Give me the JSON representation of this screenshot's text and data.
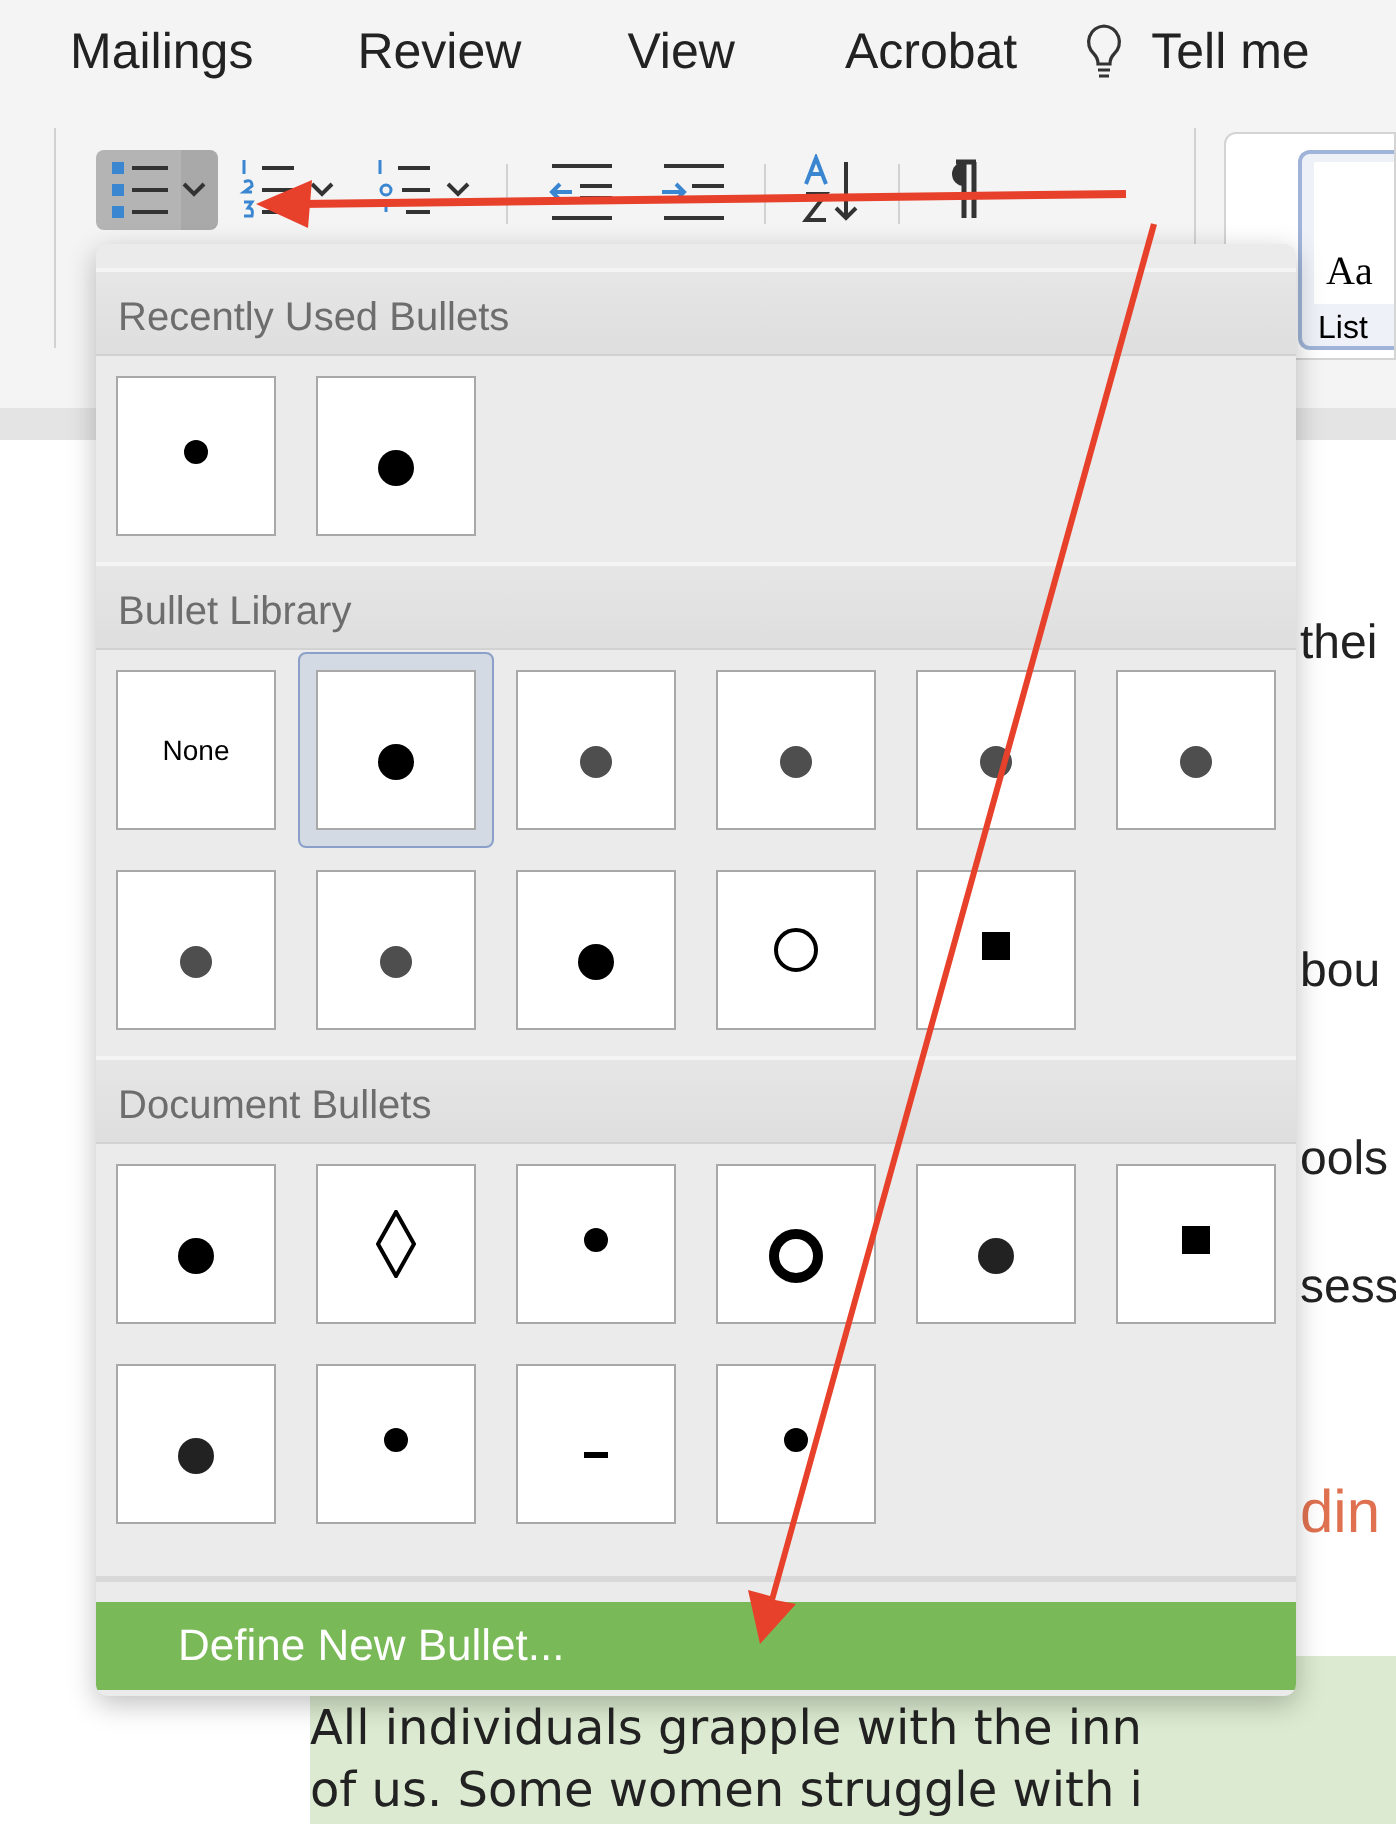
{
  "ribbon_tabs": [
    {
      "label": "Mailings"
    },
    {
      "label": "Review"
    },
    {
      "label": "View"
    },
    {
      "label": "Acrobat"
    }
  ],
  "tell_me": {
    "label": "Tell me"
  },
  "toolbar": {
    "bullets_pressed": true
  },
  "style_gallery": {
    "preview": "Aa",
    "name": "List"
  },
  "document": {
    "fragments": [
      {
        "text": "thei",
        "kind": "body"
      },
      {
        "text": "bou",
        "kind": "body"
      },
      {
        "text": "ools",
        "kind": "body"
      },
      {
        "text": "sess",
        "kind": "body"
      },
      {
        "text": "din",
        "kind": "heading"
      }
    ],
    "highlighted_lines": [
      "All individuals grapple with the inn",
      "of us. Some women struggle with i"
    ]
  },
  "bullet_menu": {
    "sections": [
      {
        "title": "Recently Used Bullets",
        "items": [
          {
            "kind": "dot-small",
            "selected": false
          },
          {
            "kind": "dot",
            "selected": false
          }
        ]
      },
      {
        "title": "Bullet Library",
        "items": [
          {
            "kind": "none",
            "label": "None",
            "selected": false
          },
          {
            "kind": "dot",
            "selected": true
          },
          {
            "kind": "dot-grey",
            "selected": false
          },
          {
            "kind": "dot-grey",
            "selected": false
          },
          {
            "kind": "dot-grey",
            "selected": false
          },
          {
            "kind": "dot-grey",
            "selected": false
          },
          {
            "kind": "dot-grey",
            "selected": false
          },
          {
            "kind": "dot-grey",
            "selected": false
          },
          {
            "kind": "dot",
            "selected": false
          },
          {
            "kind": "ring",
            "selected": false
          },
          {
            "kind": "square",
            "selected": false
          }
        ]
      },
      {
        "title": "Document Bullets",
        "items": [
          {
            "kind": "dot",
            "selected": false
          },
          {
            "kind": "diamond",
            "selected": false
          },
          {
            "kind": "dot-small",
            "selected": false
          },
          {
            "kind": "letter-o",
            "selected": false
          },
          {
            "kind": "dot-dark",
            "selected": false
          },
          {
            "kind": "square",
            "selected": false
          },
          {
            "kind": "dot-dark",
            "selected": false
          },
          {
            "kind": "dot-small",
            "selected": false
          },
          {
            "kind": "dash",
            "selected": false
          },
          {
            "kind": "dot-small",
            "selected": false
          }
        ]
      }
    ],
    "action": {
      "label": "Define New Bullet...",
      "highlighted": true
    }
  }
}
